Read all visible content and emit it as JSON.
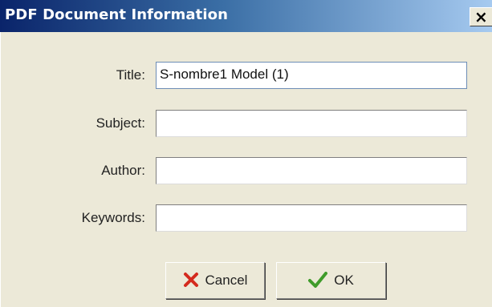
{
  "window": {
    "title": "PDF Document Information",
    "close_symbol": "×"
  },
  "form": {
    "fields": [
      {
        "label": "Title:",
        "value": "S-nombre1 Model (1)"
      },
      {
        "label": "Subject:",
        "value": ""
      },
      {
        "label": "Author:",
        "value": ""
      },
      {
        "label": "Keywords:",
        "value": ""
      }
    ]
  },
  "buttons": {
    "cancel_label": "Cancel",
    "ok_label": "OK"
  },
  "icons": {
    "cancel": "red-x-icon",
    "ok": "green-check-icon"
  },
  "colors": {
    "titlebar_start": "#0a246a",
    "titlebar_end": "#a6caf0",
    "dialog_background": "#ece9d8",
    "cancel_icon": "#d42a1e",
    "ok_icon": "#3f9b2a"
  }
}
